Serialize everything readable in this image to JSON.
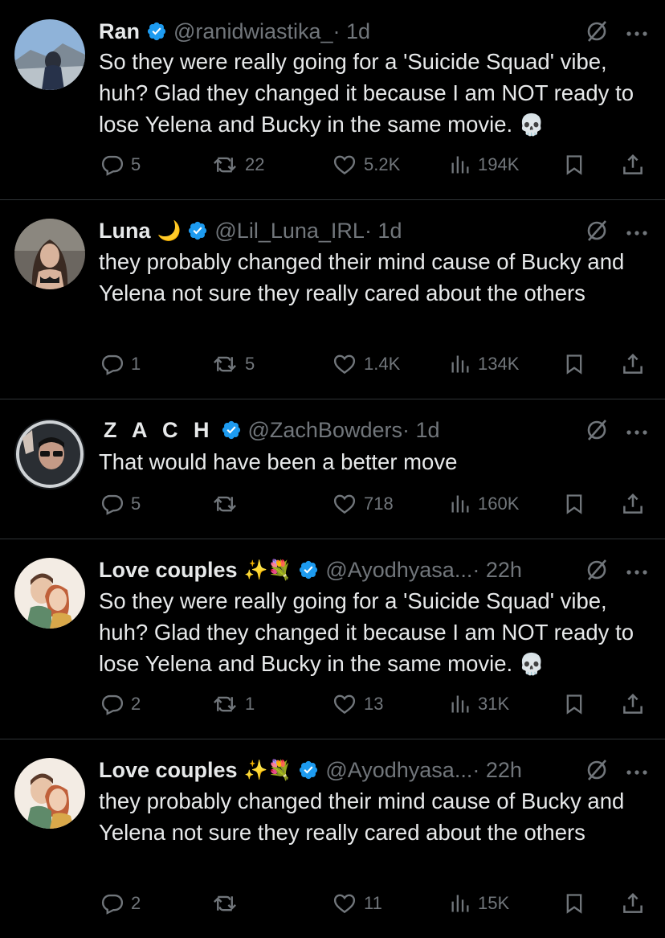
{
  "colors": {
    "background": "#000000",
    "text": "#e7e9ea",
    "muted": "#71767b",
    "verified": "#1d9bf0",
    "divider": "#2f3336"
  },
  "icons": {
    "verified": "verified-badge-icon",
    "grok": "grok-icon",
    "more": "more-icon",
    "reply": "reply-icon",
    "retweet": "retweet-icon",
    "like": "like-icon",
    "views": "views-icon",
    "bookmark": "bookmark-icon",
    "share": "share-icon"
  },
  "tweets": [
    {
      "name": "Ran",
      "name_emoji": "",
      "handle": "@ranidwiastika_",
      "time": "· 1d",
      "text": "So they were really going for a 'Suicide Squad' vibe, huh? Glad they changed it because I am NOT ready to lose Yelena and Bucky in the same movie. ",
      "trailing_emoji": "💀",
      "replies": "5",
      "retweets": "22",
      "likes": "5.2K",
      "views": "194K"
    },
    {
      "name": "Luna",
      "name_emoji": "🌙",
      "handle": "@Lil_Luna_IRL",
      "time": "· 1d",
      "text": "they probably changed their mind cause of Bucky and Yelena not sure they really cared about the others",
      "trailing_emoji": "",
      "replies": "1",
      "retweets": "5",
      "likes": "1.4K",
      "views": "134K"
    },
    {
      "name": "Z A C H",
      "name_emoji": "",
      "handle": "@ZachBowders",
      "time": "· 1d",
      "text": "That would have been a better move",
      "trailing_emoji": "",
      "replies": "5",
      "retweets": "",
      "likes": "718",
      "views": "160K"
    },
    {
      "name": "Love couples",
      "name_emoji": "✨💐",
      "handle": "@Ayodhyasa...",
      "time": "· 22h",
      "text": "So they were really going for a 'Suicide Squad' vibe, huh? Glad they changed it because I am NOT ready to lose Yelena and Bucky in the same movie. ",
      "trailing_emoji": "💀",
      "replies": "2",
      "retweets": "1",
      "likes": "13",
      "views": "31K"
    },
    {
      "name": "Love couples",
      "name_emoji": "✨💐",
      "handle": "@Ayodhyasa...",
      "time": "· 22h",
      "text": "they probably changed their mind cause of Bucky and Yelena not sure they really cared about the others",
      "trailing_emoji": "",
      "replies": "2",
      "retweets": "",
      "likes": "11",
      "views": "15K"
    }
  ]
}
